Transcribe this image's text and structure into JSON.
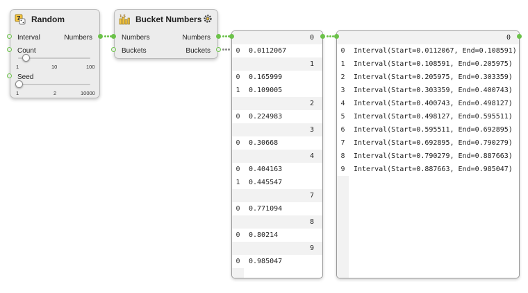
{
  "colors": {
    "port_green": "#6cc24a",
    "node_bg": "#ececec"
  },
  "nodes": {
    "random": {
      "title": "Random",
      "icon": "dice-icon",
      "inputs": [
        "Interval",
        "Count",
        "Seed"
      ],
      "output": "Numbers",
      "count_slider": {
        "ticks": [
          "1",
          "10",
          "100"
        ],
        "value": 10
      },
      "seed_slider": {
        "ticks": [
          "1",
          "2",
          "10000"
        ],
        "value": 1
      }
    },
    "bucket": {
      "title": "Bucket Numbers",
      "icon": "bucket-numbers-icon",
      "gear_icon": "gear-icon",
      "inputs": [
        "Numbers",
        "Buckets"
      ],
      "outputs": [
        "Numbers",
        "Buckets"
      ]
    }
  },
  "panel_numbers": {
    "rows": [
      {
        "kind": "h",
        "text": "0"
      },
      {
        "kind": "d",
        "i": "0",
        "v": "0.0112067"
      },
      {
        "kind": "h",
        "text": "1"
      },
      {
        "kind": "d",
        "i": "0",
        "v": "0.165999"
      },
      {
        "kind": "d",
        "i": "1",
        "v": "0.109005"
      },
      {
        "kind": "h",
        "text": "2"
      },
      {
        "kind": "d",
        "i": "0",
        "v": "0.224983"
      },
      {
        "kind": "h",
        "text": "3"
      },
      {
        "kind": "d",
        "i": "0",
        "v": "0.30668"
      },
      {
        "kind": "h",
        "text": "4"
      },
      {
        "kind": "d",
        "i": "0",
        "v": "0.404163"
      },
      {
        "kind": "d",
        "i": "1",
        "v": "0.445547"
      },
      {
        "kind": "h",
        "text": "7"
      },
      {
        "kind": "d",
        "i": "0",
        "v": "0.771094"
      },
      {
        "kind": "h",
        "text": "8"
      },
      {
        "kind": "d",
        "i": "0",
        "v": "0.80214"
      },
      {
        "kind": "h",
        "text": "9"
      },
      {
        "kind": "d",
        "i": "0",
        "v": "0.985047"
      }
    ]
  },
  "panel_buckets": {
    "rows": [
      {
        "kind": "h",
        "text": "0"
      },
      {
        "kind": "d",
        "i": "0",
        "v": "Interval(Start=0.0112067, End=0.108591)"
      },
      {
        "kind": "d",
        "i": "1",
        "v": "Interval(Start=0.108591, End=0.205975)"
      },
      {
        "kind": "d",
        "i": "2",
        "v": "Interval(Start=0.205975, End=0.303359)"
      },
      {
        "kind": "d",
        "i": "3",
        "v": "Interval(Start=0.303359, End=0.400743)"
      },
      {
        "kind": "d",
        "i": "4",
        "v": "Interval(Start=0.400743, End=0.498127)"
      },
      {
        "kind": "d",
        "i": "5",
        "v": "Interval(Start=0.498127, End=0.595511)"
      },
      {
        "kind": "d",
        "i": "6",
        "v": "Interval(Start=0.595511, End=0.692895)"
      },
      {
        "kind": "d",
        "i": "7",
        "v": "Interval(Start=0.692895, End=0.790279)"
      },
      {
        "kind": "d",
        "i": "8",
        "v": "Interval(Start=0.790279, End=0.887663)"
      },
      {
        "kind": "d",
        "i": "9",
        "v": "Interval(Start=0.887663, End=0.985047)"
      }
    ]
  }
}
